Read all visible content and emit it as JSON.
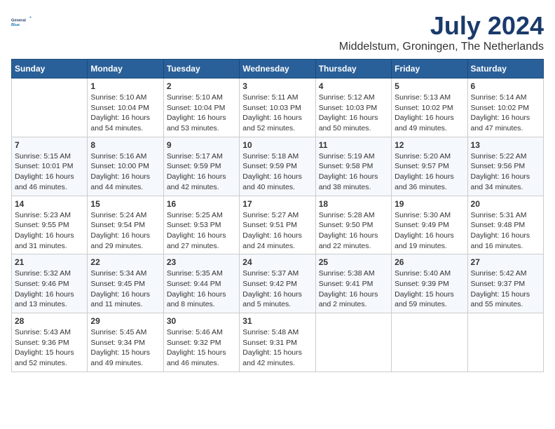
{
  "header": {
    "logo_line1": "General",
    "logo_line2": "Blue",
    "month_year": "July 2024",
    "location": "Middelstum, Groningen, The Netherlands"
  },
  "calendar": {
    "weekdays": [
      "Sunday",
      "Monday",
      "Tuesday",
      "Wednesday",
      "Thursday",
      "Friday",
      "Saturday"
    ],
    "weeks": [
      [
        {
          "day": "",
          "sunrise": "",
          "sunset": "",
          "daylight": ""
        },
        {
          "day": "1",
          "sunrise": "Sunrise: 5:10 AM",
          "sunset": "Sunset: 10:04 PM",
          "daylight": "Daylight: 16 hours and 54 minutes."
        },
        {
          "day": "2",
          "sunrise": "Sunrise: 5:10 AM",
          "sunset": "Sunset: 10:04 PM",
          "daylight": "Daylight: 16 hours and 53 minutes."
        },
        {
          "day": "3",
          "sunrise": "Sunrise: 5:11 AM",
          "sunset": "Sunset: 10:03 PM",
          "daylight": "Daylight: 16 hours and 52 minutes."
        },
        {
          "day": "4",
          "sunrise": "Sunrise: 5:12 AM",
          "sunset": "Sunset: 10:03 PM",
          "daylight": "Daylight: 16 hours and 50 minutes."
        },
        {
          "day": "5",
          "sunrise": "Sunrise: 5:13 AM",
          "sunset": "Sunset: 10:02 PM",
          "daylight": "Daylight: 16 hours and 49 minutes."
        },
        {
          "day": "6",
          "sunrise": "Sunrise: 5:14 AM",
          "sunset": "Sunset: 10:02 PM",
          "daylight": "Daylight: 16 hours and 47 minutes."
        }
      ],
      [
        {
          "day": "7",
          "sunrise": "Sunrise: 5:15 AM",
          "sunset": "Sunset: 10:01 PM",
          "daylight": "Daylight: 16 hours and 46 minutes."
        },
        {
          "day": "8",
          "sunrise": "Sunrise: 5:16 AM",
          "sunset": "Sunset: 10:00 PM",
          "daylight": "Daylight: 16 hours and 44 minutes."
        },
        {
          "day": "9",
          "sunrise": "Sunrise: 5:17 AM",
          "sunset": "Sunset: 9:59 PM",
          "daylight": "Daylight: 16 hours and 42 minutes."
        },
        {
          "day": "10",
          "sunrise": "Sunrise: 5:18 AM",
          "sunset": "Sunset: 9:59 PM",
          "daylight": "Daylight: 16 hours and 40 minutes."
        },
        {
          "day": "11",
          "sunrise": "Sunrise: 5:19 AM",
          "sunset": "Sunset: 9:58 PM",
          "daylight": "Daylight: 16 hours and 38 minutes."
        },
        {
          "day": "12",
          "sunrise": "Sunrise: 5:20 AM",
          "sunset": "Sunset: 9:57 PM",
          "daylight": "Daylight: 16 hours and 36 minutes."
        },
        {
          "day": "13",
          "sunrise": "Sunrise: 5:22 AM",
          "sunset": "Sunset: 9:56 PM",
          "daylight": "Daylight: 16 hours and 34 minutes."
        }
      ],
      [
        {
          "day": "14",
          "sunrise": "Sunrise: 5:23 AM",
          "sunset": "Sunset: 9:55 PM",
          "daylight": "Daylight: 16 hours and 31 minutes."
        },
        {
          "day": "15",
          "sunrise": "Sunrise: 5:24 AM",
          "sunset": "Sunset: 9:54 PM",
          "daylight": "Daylight: 16 hours and 29 minutes."
        },
        {
          "day": "16",
          "sunrise": "Sunrise: 5:25 AM",
          "sunset": "Sunset: 9:53 PM",
          "daylight": "Daylight: 16 hours and 27 minutes."
        },
        {
          "day": "17",
          "sunrise": "Sunrise: 5:27 AM",
          "sunset": "Sunset: 9:51 PM",
          "daylight": "Daylight: 16 hours and 24 minutes."
        },
        {
          "day": "18",
          "sunrise": "Sunrise: 5:28 AM",
          "sunset": "Sunset: 9:50 PM",
          "daylight": "Daylight: 16 hours and 22 minutes."
        },
        {
          "day": "19",
          "sunrise": "Sunrise: 5:30 AM",
          "sunset": "Sunset: 9:49 PM",
          "daylight": "Daylight: 16 hours and 19 minutes."
        },
        {
          "day": "20",
          "sunrise": "Sunrise: 5:31 AM",
          "sunset": "Sunset: 9:48 PM",
          "daylight": "Daylight: 16 hours and 16 minutes."
        }
      ],
      [
        {
          "day": "21",
          "sunrise": "Sunrise: 5:32 AM",
          "sunset": "Sunset: 9:46 PM",
          "daylight": "Daylight: 16 hours and 13 minutes."
        },
        {
          "day": "22",
          "sunrise": "Sunrise: 5:34 AM",
          "sunset": "Sunset: 9:45 PM",
          "daylight": "Daylight: 16 hours and 11 minutes."
        },
        {
          "day": "23",
          "sunrise": "Sunrise: 5:35 AM",
          "sunset": "Sunset: 9:44 PM",
          "daylight": "Daylight: 16 hours and 8 minutes."
        },
        {
          "day": "24",
          "sunrise": "Sunrise: 5:37 AM",
          "sunset": "Sunset: 9:42 PM",
          "daylight": "Daylight: 16 hours and 5 minutes."
        },
        {
          "day": "25",
          "sunrise": "Sunrise: 5:38 AM",
          "sunset": "Sunset: 9:41 PM",
          "daylight": "Daylight: 16 hours and 2 minutes."
        },
        {
          "day": "26",
          "sunrise": "Sunrise: 5:40 AM",
          "sunset": "Sunset: 9:39 PM",
          "daylight": "Daylight: 15 hours and 59 minutes."
        },
        {
          "day": "27",
          "sunrise": "Sunrise: 5:42 AM",
          "sunset": "Sunset: 9:37 PM",
          "daylight": "Daylight: 15 hours and 55 minutes."
        }
      ],
      [
        {
          "day": "28",
          "sunrise": "Sunrise: 5:43 AM",
          "sunset": "Sunset: 9:36 PM",
          "daylight": "Daylight: 15 hours and 52 minutes."
        },
        {
          "day": "29",
          "sunrise": "Sunrise: 5:45 AM",
          "sunset": "Sunset: 9:34 PM",
          "daylight": "Daylight: 15 hours and 49 minutes."
        },
        {
          "day": "30",
          "sunrise": "Sunrise: 5:46 AM",
          "sunset": "Sunset: 9:32 PM",
          "daylight": "Daylight: 15 hours and 46 minutes."
        },
        {
          "day": "31",
          "sunrise": "Sunrise: 5:48 AM",
          "sunset": "Sunset: 9:31 PM",
          "daylight": "Daylight: 15 hours and 42 minutes."
        },
        {
          "day": "",
          "sunrise": "",
          "sunset": "",
          "daylight": ""
        },
        {
          "day": "",
          "sunrise": "",
          "sunset": "",
          "daylight": ""
        },
        {
          "day": "",
          "sunrise": "",
          "sunset": "",
          "daylight": ""
        }
      ]
    ]
  }
}
